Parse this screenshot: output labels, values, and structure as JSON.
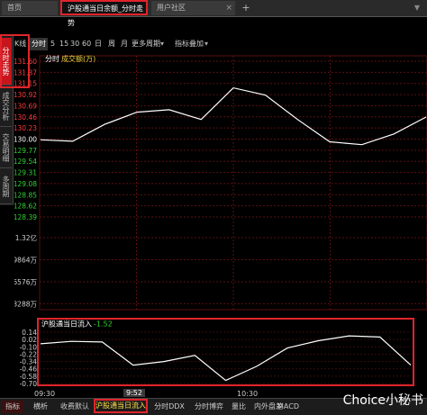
{
  "tabs": {
    "home": "首页",
    "active": "沪股通当日余额_分时走势",
    "community": "用户社区",
    "plus": "+",
    "close": "×",
    "scroll": "▼"
  },
  "side_tabs": [
    "分时走势",
    "成交分析",
    "交易明细",
    "多周期"
  ],
  "period_bar": {
    "lead": "K线",
    "active": "分时",
    "items": [
      "5",
      "15",
      "30",
      "60",
      "日",
      "周",
      "月",
      "更多周期",
      "指标叠加"
    ],
    "arrow": "▾"
  },
  "main_chart": {
    "legend_time": "分时",
    "legend_volume": "成交额(万)",
    "y_ticks": [
      "131.60",
      "131.37",
      "131.15",
      "130.92",
      "130.69",
      "130.46",
      "130.23",
      "130.00",
      "129.77",
      "129.54",
      "129.31",
      "129.08",
      "128.85",
      "128.62",
      "128.39"
    ],
    "vol_ticks": [
      "1.32亿",
      "9864万",
      "6576万",
      "3288万"
    ],
    "colors": {
      "up": "#ff3b3b",
      "base": "#ffffff",
      "down": "#32d232",
      "line": "#ffffff",
      "grid": "#5a0f0f"
    }
  },
  "flow_panel": {
    "title": "沪股通当日流入",
    "value": "-1.52",
    "y_ticks": [
      "0.14",
      "0.02",
      "-0.10",
      "-0.22",
      "-0.34",
      "-0.46",
      "-0.58",
      "-0.70"
    ]
  },
  "time_axis": {
    "start": "09:30",
    "cursor": "9:52",
    "mid": "10:30"
  },
  "bottom_tabs": [
    "指标",
    "横析",
    "收费默认",
    "沪股通当日流入",
    "分时DDX",
    "分时博弈",
    "量比",
    "内外盘差",
    "MACD"
  ],
  "watermark": "Choice小秘书",
  "chart_data": [
    {
      "type": "line",
      "title": "",
      "xlabel": "",
      "ylabel": "",
      "x": [
        "09:30",
        "09:40",
        "09:50",
        "10:00",
        "10:10",
        "10:20",
        "10:30",
        "10:40",
        "10:50",
        "11:00",
        "11:10",
        "11:20",
        "11:30"
      ],
      "series": [
        {
          "values": [
            129.98,
            129.95,
            130.3,
            130.55,
            130.6,
            130.4,
            131.05,
            130.9,
            130.4,
            129.94,
            129.88,
            130.1,
            130.45
          ]
        }
      ],
      "ylim": [
        128.39,
        131.6
      ],
      "grid": true
    },
    {
      "type": "line",
      "title": "沪股通当日流入",
      "x": [
        "09:30",
        "09:40",
        "09:50",
        "10:00",
        "10:10",
        "10:20",
        "10:30",
        "10:40",
        "10:50",
        "11:00",
        "11:10",
        "11:20",
        "11:30"
      ],
      "series": [
        {
          "name": "沪股通当日流入",
          "values": [
            -0.05,
            -0.01,
            -0.02,
            -0.4,
            -0.34,
            -0.24,
            -0.65,
            -0.42,
            -0.12,
            0.0,
            0.08,
            0.06,
            -0.4
          ]
        }
      ],
      "ylim": [
        -0.7,
        0.14
      ]
    }
  ]
}
